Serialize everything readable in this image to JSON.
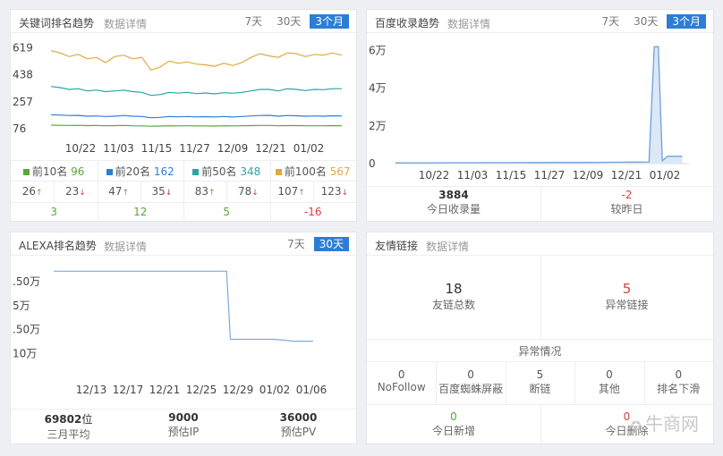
{
  "colors": {
    "accent": "#2b7ed5",
    "green": "#5aa53a",
    "red": "#d14343"
  },
  "kw": {
    "title": "关键词排名趋势",
    "link": "数据详情",
    "tabs": [
      "7天",
      "30天",
      "3个月"
    ],
    "legend": [
      {
        "label": "前10名",
        "value": "96",
        "color": "#5aa53a"
      },
      {
        "label": "前20名",
        "value": "162",
        "color": "#2b7ed5"
      },
      {
        "label": "前50名",
        "value": "348",
        "color": "#2aa5a5"
      },
      {
        "label": "前100名",
        "value": "567",
        "color": "#e0a93f"
      }
    ],
    "changes": [
      {
        "value": "26",
        "dir": "up"
      },
      {
        "value": "23",
        "dir": "down"
      },
      {
        "value": "47",
        "dir": "up"
      },
      {
        "value": "35",
        "dir": "down"
      },
      {
        "value": "83",
        "dir": "up"
      },
      {
        "value": "78",
        "dir": "down"
      },
      {
        "value": "107",
        "dir": "up"
      },
      {
        "value": "123",
        "dir": "down"
      }
    ],
    "net": [
      {
        "value": "3",
        "color": "#5aa53a"
      },
      {
        "value": "12",
        "color": "#5aa53a"
      },
      {
        "value": "5",
        "color": "#5aa53a"
      },
      {
        "value": "-16",
        "color": "#d14343"
      }
    ]
  },
  "baidu": {
    "title": "百度收录趋势",
    "link": "数据详情",
    "tabs": [
      "7天",
      "30天",
      "3个月"
    ],
    "stats": [
      {
        "value": "3884",
        "label": "今日收录量",
        "color": "#333"
      },
      {
        "value": "-2",
        "label": "较昨日",
        "color": "#d14343"
      }
    ]
  },
  "alexa": {
    "title": "ALEXA排名趋势",
    "link": "数据详情",
    "tabs": [
      "7天",
      "30天"
    ],
    "stats": [
      {
        "value": "69802",
        "unit": "位",
        "label": "三月平均"
      },
      {
        "value": "9000",
        "unit": "",
        "label": "预估IP"
      },
      {
        "value": "36000",
        "unit": "",
        "label": "预估PV"
      }
    ]
  },
  "links": {
    "title": "友情链接",
    "link": "数据详情",
    "top": [
      {
        "value": "18",
        "label": "友链总数",
        "color": "#333"
      },
      {
        "value": "5",
        "label": "异常链接",
        "color": "#d14343"
      }
    ],
    "abnormal_title": "异常情况",
    "abnormal": [
      {
        "value": "0",
        "label": "NoFollow"
      },
      {
        "value": "0",
        "label": "百度蜘蛛屏蔽"
      },
      {
        "value": "5",
        "label": "断链"
      },
      {
        "value": "0",
        "label": "其他"
      },
      {
        "value": "0",
        "label": "排名下滑"
      }
    ],
    "bottom": [
      {
        "value": "0",
        "label": "今日新增",
        "color": "#5aa53a"
      },
      {
        "value": "0",
        "label": "今日删除",
        "color": "#d14343"
      }
    ]
  },
  "watermark": "牛商网",
  "chart_data": [
    {
      "type": "line",
      "title": "关键词排名趋势",
      "x": [
        "10/22",
        "11/03",
        "11/15",
        "11/27",
        "12/09",
        "12/21",
        "01/02"
      ],
      "y_ticks": [
        76,
        257,
        438,
        619
      ],
      "ylim": [
        40,
        640
      ],
      "series": [
        {
          "name": "前100名",
          "color": "#e0a93f",
          "values": [
            600,
            585,
            560,
            575,
            545,
            555,
            520,
            560,
            570,
            545,
            555,
            470,
            490,
            530,
            515,
            525,
            510,
            505,
            495,
            515,
            500,
            520,
            555,
            580,
            565,
            555,
            585,
            580,
            560,
            575,
            570,
            585,
            570
          ]
        },
        {
          "name": "前50名",
          "color": "#2aa5a5",
          "values": [
            360,
            352,
            340,
            345,
            330,
            336,
            325,
            330,
            335,
            325,
            320,
            300,
            305,
            320,
            315,
            320,
            312,
            316,
            310,
            318,
            315,
            320,
            330,
            340,
            340,
            330,
            345,
            340,
            332,
            340,
            338,
            345,
            345
          ]
        },
        {
          "name": "前20名",
          "color": "#2b7ed5",
          "values": [
            170,
            168,
            165,
            166,
            160,
            162,
            158,
            160,
            165,
            160,
            158,
            150,
            152,
            158,
            156,
            158,
            155,
            157,
            155,
            158,
            155,
            158,
            162,
            165,
            166,
            160,
            165,
            163,
            160,
            162,
            160,
            163,
            162
          ]
        },
        {
          "name": "前10名",
          "color": "#5aa53a",
          "values": [
            100,
            99,
            98,
            99,
            97,
            98,
            96,
            97,
            98,
            96,
            95,
            93,
            94,
            96,
            95,
            96,
            95,
            95,
            94,
            96,
            95,
            96,
            97,
            98,
            98,
            96,
            97,
            97,
            96,
            96,
            96,
            97,
            96
          ]
        }
      ]
    },
    {
      "type": "area",
      "title": "百度收录趋势",
      "x": [
        "10/22",
        "11/03",
        "11/15",
        "11/27",
        "12/09",
        "12/21",
        "01/02"
      ],
      "y_ticks": [
        {
          "v": 0,
          "label": "0"
        },
        {
          "v": 20000,
          "label": "2万"
        },
        {
          "v": 40000,
          "label": "4万"
        },
        {
          "v": 60000,
          "label": "6万"
        }
      ],
      "ylim": [
        0,
        65000
      ],
      "points": [
        [
          0,
          400
        ],
        [
          1,
          420
        ],
        [
          2,
          430
        ],
        [
          3,
          440
        ],
        [
          4,
          460
        ],
        [
          5,
          480
        ],
        [
          6,
          490
        ],
        [
          7,
          500
        ],
        [
          8,
          520
        ],
        [
          9,
          540
        ],
        [
          10,
          560
        ],
        [
          11,
          580
        ],
        [
          12,
          600
        ],
        [
          13,
          620
        ],
        [
          14,
          640
        ],
        [
          15,
          660
        ],
        [
          16,
          700
        ],
        [
          17,
          760
        ],
        [
          18,
          820
        ],
        [
          19,
          880
        ],
        [
          19.4,
          62000
        ],
        [
          19.7,
          62000
        ],
        [
          20.0,
          1500
        ],
        [
          20.4,
          3884
        ],
        [
          21.0,
          3884
        ],
        [
          21.5,
          3884
        ]
      ],
      "x_max": 22
    },
    {
      "type": "line",
      "title": "ALEXA排名趋势",
      "x": [
        "12/13",
        "12/17",
        "12/21",
        "12/25",
        "12/29",
        "01/02",
        "01/06"
      ],
      "y_ticks": [
        {
          "v": 10,
          "label": "10万"
        },
        {
          "v": 7.5,
          "label": ".50万"
        },
        {
          "v": 5,
          "label": "5万"
        },
        {
          "v": 2.5,
          "label": ".50万"
        }
      ],
      "ylim": [
        1,
        12
      ],
      "points": [
        [
          0,
          1.4
        ],
        [
          1,
          1.4
        ],
        [
          2,
          1.4
        ],
        [
          3,
          1.4
        ],
        [
          4,
          1.4
        ],
        [
          5,
          1.4
        ],
        [
          6,
          1.4
        ],
        [
          7,
          1.4
        ],
        [
          8,
          1.4
        ],
        [
          9,
          1.4
        ],
        [
          10,
          1.4
        ],
        [
          11,
          1.4
        ],
        [
          12,
          1.4
        ],
        [
          13,
          1.4
        ],
        [
          14,
          1.4
        ],
        [
          15,
          1.4
        ],
        [
          16,
          1.4
        ],
        [
          17,
          1.4
        ],
        [
          18,
          1.4
        ],
        [
          18.4,
          8.5
        ],
        [
          19,
          8.5
        ],
        [
          20,
          8.5
        ],
        [
          21,
          8.5
        ],
        [
          22,
          8.5
        ],
        [
          23,
          8.5
        ],
        [
          24,
          8.6
        ],
        [
          25,
          8.7
        ],
        [
          26,
          8.7
        ],
        [
          27,
          8.7
        ]
      ],
      "x_max": 30,
      "invert": true
    }
  ]
}
